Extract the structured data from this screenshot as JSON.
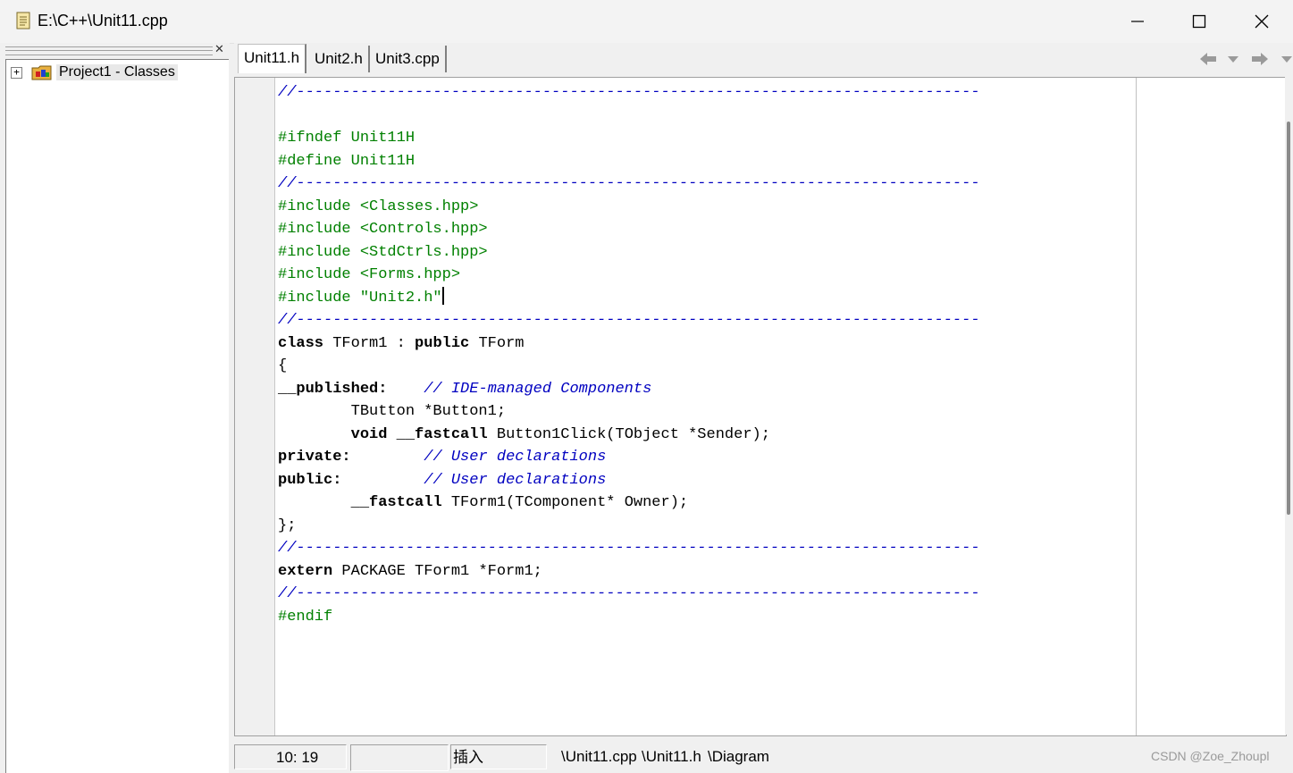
{
  "window": {
    "title": "E:\\C++\\Unit11.cpp"
  },
  "explorer": {
    "tree_root_label": "Project1 - Classes",
    "expander": "+"
  },
  "tabs": [
    {
      "label": "Unit11.h",
      "active": true
    },
    {
      "label": "Unit2.h",
      "active": false
    },
    {
      "label": "Unit3.cpp",
      "active": false
    }
  ],
  "code_lines": [
    [
      {
        "t": "//---------------------------------------------------------------------------",
        "c": "cmt"
      }
    ],
    [],
    [
      {
        "t": "#ifndef Unit11H",
        "c": "dir"
      }
    ],
    [
      {
        "t": "#define Unit11H",
        "c": "dir"
      }
    ],
    [
      {
        "t": "//---------------------------------------------------------------------------",
        "c": "cmt"
      }
    ],
    [
      {
        "t": "#include <Classes.hpp>",
        "c": "dir"
      }
    ],
    [
      {
        "t": "#include <Controls.hpp>",
        "c": "dir"
      }
    ],
    [
      {
        "t": "#include <StdCtrls.hpp>",
        "c": "dir"
      }
    ],
    [
      {
        "t": "#include <Forms.hpp>",
        "c": "dir"
      }
    ],
    [
      {
        "t": "#include \"Unit2.h\"",
        "c": "dir"
      },
      {
        "t": "",
        "c": "caret"
      }
    ],
    [
      {
        "t": "//---------------------------------------------------------------------------",
        "c": "cmt"
      }
    ],
    [
      {
        "t": "class",
        "c": "kw"
      },
      {
        "t": " TForm1 : ",
        "c": "pl"
      },
      {
        "t": "public",
        "c": "kw"
      },
      {
        "t": " TForm",
        "c": "pl"
      }
    ],
    [
      {
        "t": "{",
        "c": "pl"
      }
    ],
    [
      {
        "t": "__published:",
        "c": "kw"
      },
      {
        "t": "    ",
        "c": "pl"
      },
      {
        "t": "// IDE-managed Components",
        "c": "cmt"
      }
    ],
    [
      {
        "t": "        TButton *Button1;",
        "c": "pl"
      }
    ],
    [
      {
        "t": "        ",
        "c": "pl"
      },
      {
        "t": "void",
        "c": "kw"
      },
      {
        "t": " ",
        "c": "pl"
      },
      {
        "t": "__fastcall",
        "c": "kw"
      },
      {
        "t": " Button1Click(TObject *Sender);",
        "c": "pl"
      }
    ],
    [
      {
        "t": "private:",
        "c": "kw"
      },
      {
        "t": "        ",
        "c": "pl"
      },
      {
        "t": "// User declarations",
        "c": "cmt"
      }
    ],
    [
      {
        "t": "public:",
        "c": "kw"
      },
      {
        "t": "         ",
        "c": "pl"
      },
      {
        "t": "// User declarations",
        "c": "cmt"
      }
    ],
    [
      {
        "t": "        ",
        "c": "pl"
      },
      {
        "t": "__fastcall",
        "c": "kw"
      },
      {
        "t": " TForm1(TComponent* Owner);",
        "c": "pl"
      }
    ],
    [
      {
        "t": "};",
        "c": "pl"
      }
    ],
    [
      {
        "t": "//---------------------------------------------------------------------------",
        "c": "cmt"
      }
    ],
    [
      {
        "t": "extern",
        "c": "kw"
      },
      {
        "t": " PACKAGE TForm1 *Form1;",
        "c": "pl"
      }
    ],
    [
      {
        "t": "//---------------------------------------------------------------------------",
        "c": "cmt"
      }
    ],
    [
      {
        "t": "#endif",
        "c": "dir"
      }
    ]
  ],
  "status": {
    "position": "10: 19",
    "mode": "插入",
    "bottom_tabs": [
      "\\Unit11.cpp",
      "\\Unit11.h",
      "\\Diagram"
    ]
  },
  "watermark": "CSDN @Zoe_Zhoupl",
  "colors": {
    "directive": "#008000",
    "comment": "#0000c0",
    "keyword": "#000000"
  }
}
